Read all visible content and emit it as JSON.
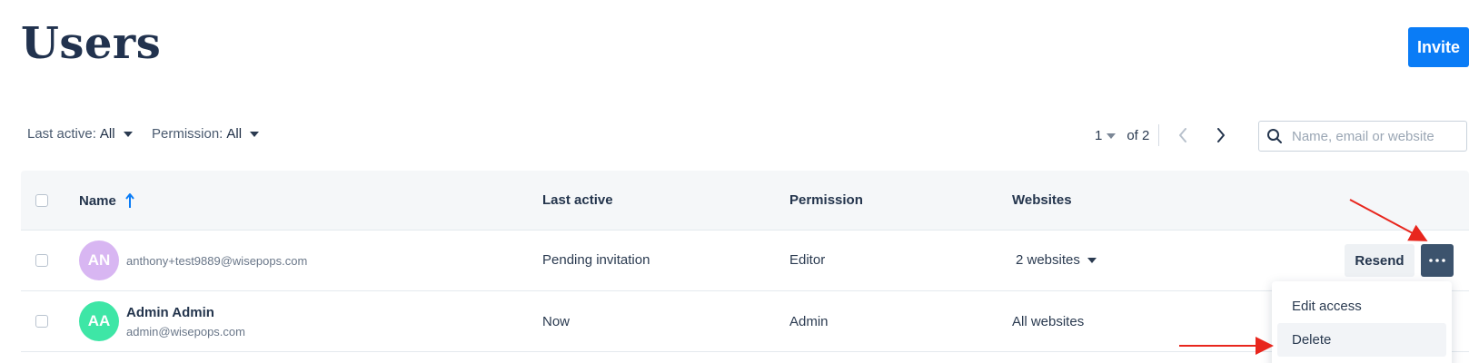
{
  "header": {
    "title": "Users",
    "invite_label": "Invite"
  },
  "filters": {
    "last_active": {
      "label": "Last active:",
      "value": "All"
    },
    "permission": {
      "label": "Permission:",
      "value": "All"
    }
  },
  "pagination": {
    "current_page": "1",
    "total_label": "of 2"
  },
  "search": {
    "placeholder": "Name, email or website"
  },
  "table": {
    "columns": {
      "name": "Name",
      "last_active": "Last active",
      "permission": "Permission",
      "websites": "Websites"
    },
    "rows": [
      {
        "initials": "AN",
        "avatar_color": "#d8b6f2",
        "name": "",
        "email": "anthony+test9889@wisepops.com",
        "last_active": "Pending invitation",
        "permission": "Editor",
        "websites": "2 websites",
        "resend_label": "Resend"
      },
      {
        "initials": "AA",
        "avatar_color": "#3ee6a6",
        "name": "Admin Admin",
        "email": "admin@wisepops.com",
        "last_active": "Now",
        "permission": "Admin",
        "websites": "All websites"
      }
    ]
  },
  "row_menu": {
    "items": [
      "Edit access",
      "Delete"
    ]
  },
  "colors": {
    "accent": "#0a7cf6",
    "more_button": "#3c536d",
    "annotation_arrow": "#e8261d",
    "title": "#21324e"
  },
  "icons": {
    "sort": "arrow-up-icon",
    "search": "search-icon",
    "prev": "chevron-left-icon",
    "next": "chevron-right-icon",
    "more": "ellipsis-icon"
  }
}
